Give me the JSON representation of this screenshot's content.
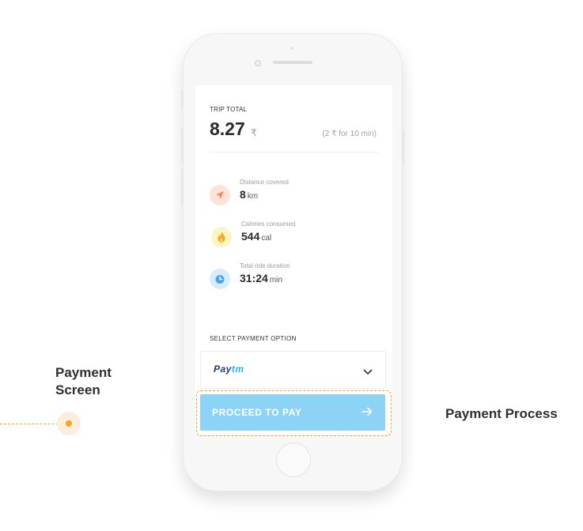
{
  "annotations": {
    "screen_title_line1": "Payment",
    "screen_title_line2": "Screen",
    "process_label": "Payment Process"
  },
  "trip": {
    "label": "TRIP TOTAL",
    "amount": "8.27",
    "currency_symbol": "₹",
    "rate": "(2 ₹ for 10 min)"
  },
  "stats": [
    {
      "icon": "navigation-arrow-icon",
      "label": "Distance covered",
      "value": "8",
      "unit": "km"
    },
    {
      "icon": "flame-icon",
      "label": "Calories consumed",
      "value": "544",
      "unit": "cal"
    },
    {
      "icon": "stopwatch-icon",
      "label": "Total ride duration",
      "value": "31:24",
      "unit": "min"
    }
  ],
  "payment": {
    "section_label": "SELECT PAYMENT OPTION",
    "selected_option": {
      "brand_part1": "Pay",
      "brand_part2": "tm"
    },
    "proceed_label": "PROCEED TO PAY"
  },
  "colors": {
    "accent_orange": "#f5a623",
    "button_blue": "#8cd3f6",
    "distance_icon_bg": "#fde3d6",
    "calories_icon_bg": "#fff4c2",
    "duration_icon_bg": "#d8ecff"
  }
}
